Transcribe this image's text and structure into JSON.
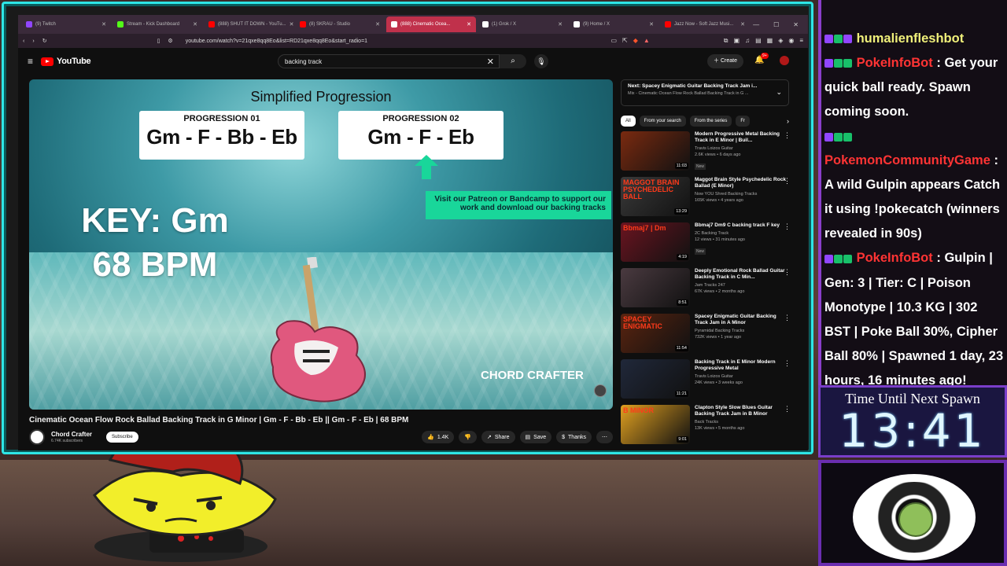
{
  "tabs": [
    {
      "title": "(9) Twitch",
      "color": "#9146ff"
    },
    {
      "title": "Stream - Kick Dashboard",
      "color": "#53fc18"
    },
    {
      "title": "(888) SHUT IT DOWN - YouTu...",
      "color": "#ff0000"
    },
    {
      "title": "(8) SKRAU - Studio",
      "color": "#ff0000"
    },
    {
      "title": "(888) Cinematic Ocea...",
      "color": "#ff0000",
      "active": true
    },
    {
      "title": "(1) Grok / X",
      "color": "#ffffff"
    },
    {
      "title": "(9) Home / X",
      "color": "#ffffff"
    },
    {
      "title": "Jazz Now - Soft Jazz Musi...",
      "color": "#ff0000"
    }
  ],
  "address": {
    "url": "youtube.com/watch?v=21qxe8qq8Eo&list=RD21qxe8qq8Eo&start_radio=1"
  },
  "youtube": {
    "logo": "YouTube",
    "search_value": "backing track",
    "create_label": "Create",
    "notif_count": "9+"
  },
  "video": {
    "overlay_title": "Simplified Progression",
    "prog1_label": "PROGRESSION 01",
    "prog1_chords": "Gm - F - Bb - Eb",
    "prog2_label": "PROGRESSION 02",
    "prog2_chords": "Gm - F - Eb",
    "patreon": "Visit our Patreon or Bandcamp to support our work and download our backing tracks",
    "key": "KEY: Gm",
    "bpm": "68 BPM",
    "watermark": "CHORD CRAFTER",
    "title": "Cinematic Ocean Flow Rock Ballad Backing Track in G Minor | Gm - F - Bb - Eb || Gm - F - Eb | 68 BPM",
    "channel": "Chord Crafter",
    "subs": "6.74K subscribers",
    "subscribe": "Subscribe",
    "likes": "1.4K",
    "share": "Share",
    "save": "Save",
    "thanks": "Thanks"
  },
  "next": {
    "title": "Next: Spacey Enigmatic Guitar Backing Track Jam i...",
    "sub": "Mix - Cinematic Ocean Flow Rock Ballad Backing Track in G ..."
  },
  "chips": [
    "All",
    "From your search",
    "From the series",
    "Fr"
  ],
  "recs": [
    {
      "title": "Modern Progressive Metal Backing Track in E Minor | Buil...",
      "channel": "Travis Loizos Guitar",
      "views": "2.6K views • 6 days ago",
      "dur": "11:03",
      "new": "New",
      "thumb": "#7a2a10",
      "thumbtxt": ""
    },
    {
      "title": "Maggot Brain Style Psychedelic Rock Ballad (E Minor)",
      "channel": "Now YOU Shred Backing Tracks",
      "views": "165K views • 4 years ago",
      "dur": "13:29",
      "new": "",
      "thumb": "#3a3a3a",
      "thumbtxt": "MAGGOT BRAIN PSYCHEDELIC BALL"
    },
    {
      "title": "Bbmaj7 Dm9 C backing track F key",
      "channel": "2C Backing Track",
      "views": "12 views • 31 minutes ago",
      "dur": "4:19",
      "new": "New",
      "thumb": "#6a1420",
      "thumbtxt": "Bbmaj7 | Dm"
    },
    {
      "title": "Deeply Emotional Rock Ballad Guitar Backing Track in C Min...",
      "channel": "Jam Tracks 247",
      "views": "67K views • 2 months ago",
      "dur": "8:51",
      "new": "",
      "thumb": "#4a3a40",
      "thumbtxt": ""
    },
    {
      "title": "Spacey Enigmatic Guitar Backing Track Jam in A Minor",
      "channel": "Pyramidal Backing Tracks",
      "views": "732K views • 1 year ago",
      "dur": "11:54",
      "new": "",
      "thumb": "#5a2410",
      "thumbtxt": "SPACEY ENIGMATIC"
    },
    {
      "title": "Backing Track in E Minor Modern Progressive Metal",
      "channel": "Travis Loizos Guitar",
      "views": "24K views • 3 weeks ago",
      "dur": "11:21",
      "new": "",
      "thumb": "#20283a",
      "thumbtxt": ""
    },
    {
      "title": "Clapton Style Slow Blues Guitar Backing Track Jam in B Minor",
      "channel": "Back Tracks",
      "views": "13K views • 5 months ago",
      "dur": "9:01",
      "new": "",
      "thumb": "#e0a020",
      "thumbtxt": "B MINOR"
    }
  ],
  "chat": [
    {
      "user": "humalienfleshbot",
      "ucolor": "#f0f07a",
      "text": "",
      "badges": [
        "#9146ff",
        "#18c06a",
        "#9146ff"
      ]
    },
    {
      "user": "PokeInfoBot",
      "ucolor": "#ff3434",
      "text": "Get your quick ball ready. Spawn coming soon.",
      "badges": [
        "#9146ff",
        "#18c06a",
        "#18c06a"
      ]
    },
    {
      "user": "PokemonCommunityGame",
      "ucolor": "#ff3434",
      "text": "A wild Gulpin appears Catch it using !pokecatch (winners revealed in 90s)",
      "badges": [
        "#9146ff",
        "#18c06a",
        "#18c06a"
      ]
    },
    {
      "user": "PokeInfoBot",
      "ucolor": "#ff3434",
      "text": "Gulpin | Gen: 3 | Tier: C | Poison Monotype | 10.3 KG | 302 BST | Poke Ball 30%, Cipher Ball 80% | Spawned 1 day, 23 hours, 16 minutes ago!",
      "badges": [
        "#9146ff",
        "#18c06a",
        "#18c06a"
      ]
    },
    {
      "user": "humalienfleshbot",
      "ucolor": "#f0f07a",
      "text": "",
      "badges": [
        "#9146ff",
        "#18c06a",
        "#9146ff"
      ]
    }
  ],
  "timer": {
    "label": "Time Until Next Spawn",
    "value": "13:41"
  }
}
